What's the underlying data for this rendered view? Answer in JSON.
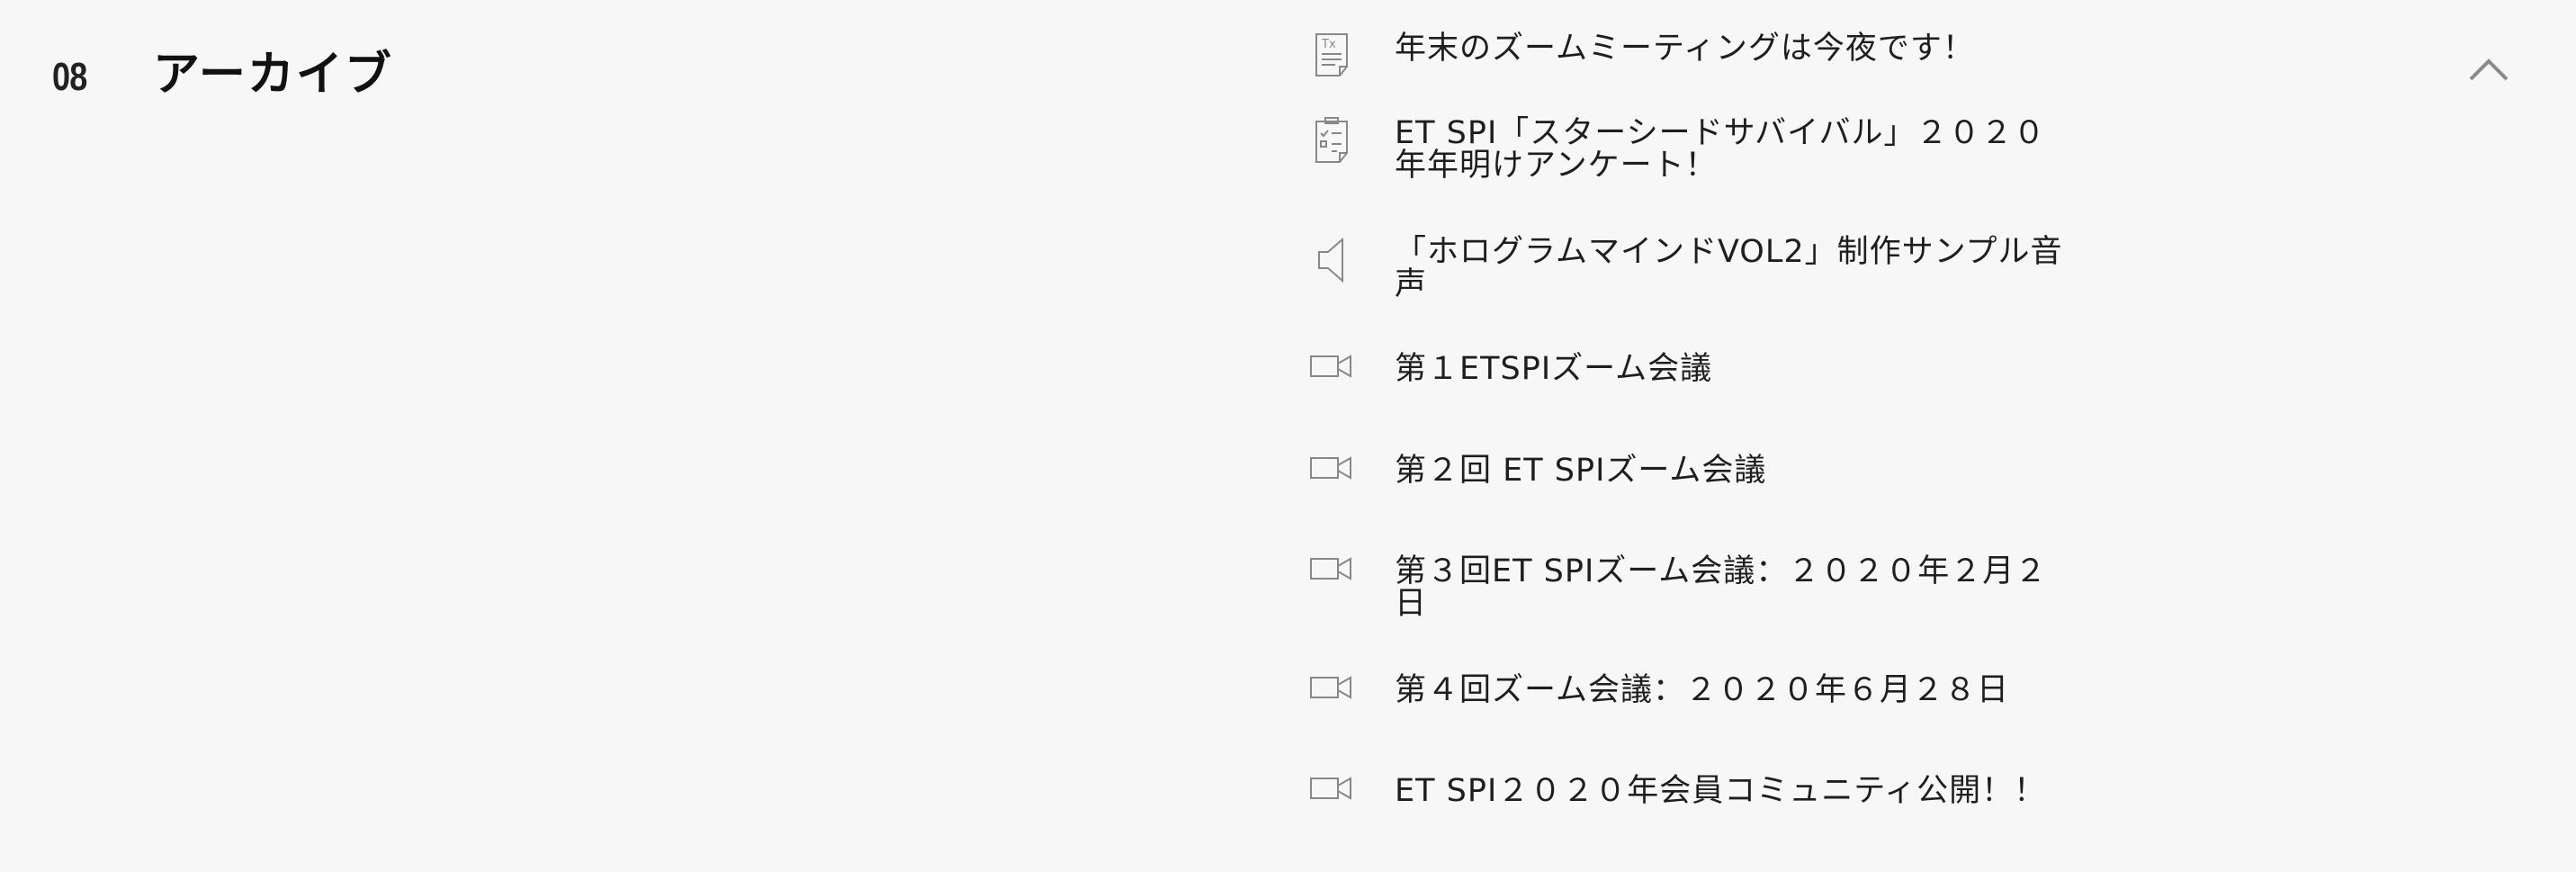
{
  "section": {
    "number": "08",
    "title": "アーカイブ"
  },
  "archive": {
    "items": [
      {
        "icon": "text-document-icon",
        "label": "年末のズームミーティングは今夜です！"
      },
      {
        "icon": "survey-clipboard-icon",
        "label": "ET SPI「スターシードサバイバル」２０２０\n年年明けアンケート！"
      },
      {
        "icon": "speaker-audio-icon",
        "label": "「ホログラムマインドVOL2」制作サンプル音\n声"
      },
      {
        "icon": "video-camera-icon",
        "label": "第１ETSPIズーム会議"
      },
      {
        "icon": "video-camera-icon",
        "label": "第２回 ET SPIズーム会議"
      },
      {
        "icon": "video-camera-icon",
        "label": "第３回ET SPIズーム会議：２０２０年２月２\n日"
      },
      {
        "icon": "video-camera-icon",
        "label": "第４回ズーム会議：２０２０年６月２８日"
      },
      {
        "icon": "video-camera-icon",
        "label": "ET SPI２０２０年会員コミュニティ公開！！"
      }
    ]
  },
  "toggle": {
    "icon": "chevron-up-icon"
  },
  "colors": {
    "background": "#f7f7f7",
    "text": "#1e1e1e",
    "icon": "#888888"
  }
}
